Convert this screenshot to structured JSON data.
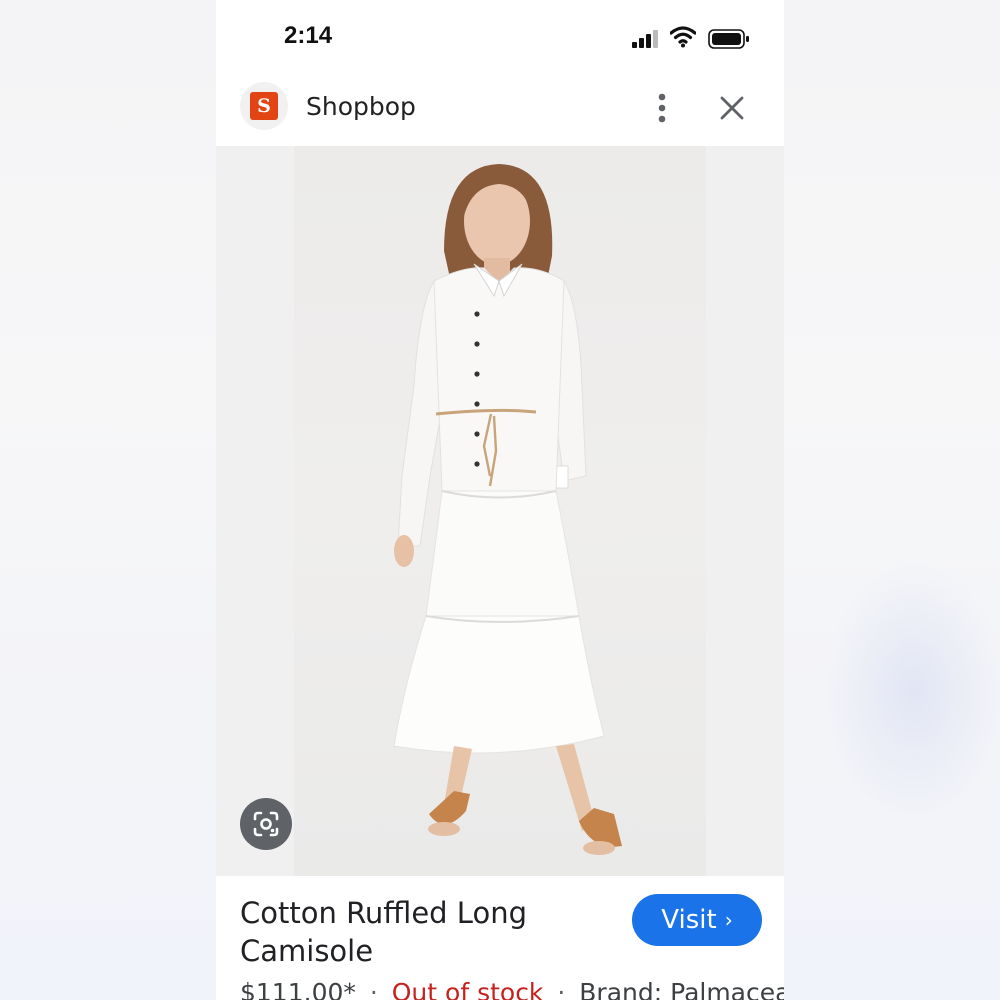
{
  "status_bar": {
    "time": "2:14"
  },
  "header": {
    "site_name": "Shopbop",
    "logo_letter": "S"
  },
  "product": {
    "title": "Cotton Ruffled Long Camisole",
    "price": "$111.00*",
    "separator": "·",
    "availability": "Out of stock",
    "brand": "Brand: Palmacea"
  },
  "actions": {
    "visit_label": "Visit",
    "visit_chevron": "›"
  },
  "colors": {
    "brand": "#e24414",
    "visit_button": "#1a73e8",
    "out_of_stock": "#c5221f",
    "lens_button": "#5f6266"
  },
  "icons": [
    "signal-icon",
    "wifi-icon",
    "battery-icon",
    "more-vert-icon",
    "close-icon",
    "google-lens-icon"
  ]
}
